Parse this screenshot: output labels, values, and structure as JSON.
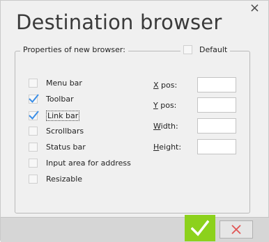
{
  "window": {
    "title": "Destination browser",
    "close_glyph": "×"
  },
  "group": {
    "label": "Properties of new browser:",
    "default_label": "Default",
    "default_checked": false
  },
  "options": [
    {
      "label": "Menu bar",
      "checked": false
    },
    {
      "label": "Toolbar",
      "checked": true
    },
    {
      "label": "Link bar",
      "checked": true
    },
    {
      "label": "Scrollbars",
      "checked": false
    },
    {
      "label": "Status bar",
      "checked": false
    },
    {
      "label": "Input area for address",
      "checked": false
    },
    {
      "label": "Resizable",
      "checked": false
    }
  ],
  "fields": [
    {
      "label_mnemonic": "X",
      "label_rest": " pos:",
      "value": ""
    },
    {
      "label_mnemonic": "Y",
      "label_rest": " pos:",
      "value": ""
    },
    {
      "label_mnemonic": "W",
      "label_rest": "idth:",
      "value": ""
    },
    {
      "label_mnemonic": "H",
      "label_rest": "eight:",
      "value": ""
    }
  ],
  "buttons": {
    "ok_icon": "checkmark-icon",
    "cancel_icon": "cross-icon"
  },
  "colors": {
    "ok": "#8cd11c",
    "check": "#3b8ee6",
    "cancel_x": "#e05555"
  }
}
